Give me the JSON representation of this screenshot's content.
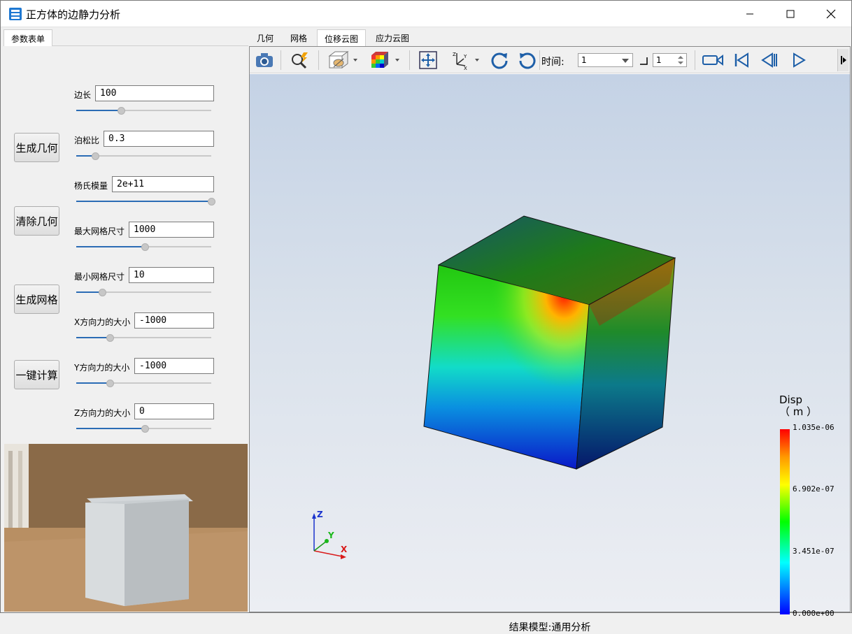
{
  "window": {
    "title": "正方体的边静力分析"
  },
  "left_tabs": [
    {
      "label": "参数表单"
    }
  ],
  "view_tabs": [
    {
      "label": "几何"
    },
    {
      "label": "网格"
    },
    {
      "label": "位移云图",
      "active": true
    },
    {
      "label": "应力云图"
    }
  ],
  "actions": {
    "generate_geometry": "生成几何",
    "clear_geometry": "清除几何",
    "generate_mesh": "生成网格",
    "compute": "一键计算"
  },
  "params": [
    {
      "label": "边长",
      "value": "100",
      "slider": 0.33
    },
    {
      "label": "泊松比",
      "value": "0.3",
      "slider": 0.14
    },
    {
      "label": "杨氏模量",
      "value": "2e+11",
      "slider": 1.0
    },
    {
      "label": "最大网格尺寸",
      "value": "1000",
      "slider": 0.51
    },
    {
      "label": "最小网格尺寸",
      "value": "10",
      "slider": 0.19
    },
    {
      "label": "X方向力的大小",
      "value": "-1000",
      "slider": 0.25
    },
    {
      "label": "Y方向力的大小",
      "value": "-1000",
      "slider": 0.25
    },
    {
      "label": "Z方向力的大小",
      "value": "0",
      "slider": 0.51
    }
  ],
  "toolbar": {
    "time_label": "时间:",
    "time_value": "1",
    "step_value": "1"
  },
  "legend": {
    "title_line1": "Disp",
    "title_line2": "（ m ）",
    "ticks": [
      "1.035e-06",
      "6.902e-07",
      "3.451e-07",
      "0.000e+00"
    ]
  },
  "axes": {
    "x": "X",
    "y": "Y",
    "z": "Z"
  },
  "model_label": "结果模型:通用分析",
  "icons": [
    "app-icon",
    "minimize-icon",
    "maximize-icon",
    "close-icon",
    "camera-icon",
    "zoom-icon",
    "display-mode-icon",
    "colormap-icon",
    "fit-view-icon",
    "axes-view-icon",
    "rotate-cw-icon",
    "rotate-ccw-icon",
    "record-icon",
    "first-frame-icon",
    "prev-frame-icon",
    "play-icon",
    "more-icon"
  ]
}
